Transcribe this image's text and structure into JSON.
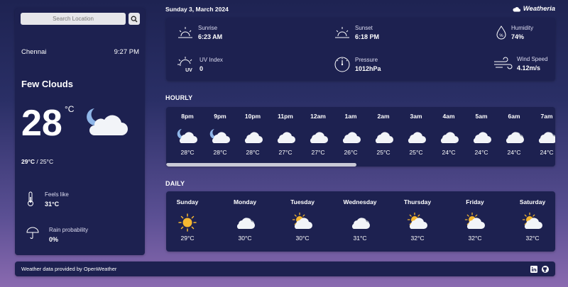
{
  "search": {
    "placeholder": "Search Location",
    "icon": "search-icon"
  },
  "location": {
    "city": "Chennai",
    "time": "9:27 PM"
  },
  "current": {
    "condition": "Few Clouds",
    "temp": "28",
    "unit": "°C",
    "hilo_high": "29°C",
    "hilo_sep": " / ",
    "hilo_low": "25°C",
    "feels_like_label": "Feels like",
    "feels_like": "31°C",
    "rain_label": "Rain probability",
    "rain": "0%"
  },
  "header": {
    "date": "Sunday 3, March 2024",
    "brand": "Weatheria"
  },
  "stats": {
    "sunrise_label": "Sunrise",
    "sunrise": "6:23 AM",
    "sunset_label": "Sunset",
    "sunset": "6:18 PM",
    "humidity_label": "Humidity",
    "humidity": "74%",
    "uv_label": "UV Index",
    "uv": "0",
    "pressure_label": "Pressure",
    "pressure": "1012hPa",
    "wind_label": "Wind Speed",
    "wind": "4.12m/s"
  },
  "hourly_title": "HOURLY",
  "hourly": [
    {
      "time": "8pm",
      "temp": "28°C",
      "icon": "moon-cloud"
    },
    {
      "time": "9pm",
      "temp": "28°C",
      "icon": "moon-cloud"
    },
    {
      "time": "10pm",
      "temp": "28°C",
      "icon": "cloud"
    },
    {
      "time": "11pm",
      "temp": "27°C",
      "icon": "cloud"
    },
    {
      "time": "12am",
      "temp": "27°C",
      "icon": "cloud"
    },
    {
      "time": "1am",
      "temp": "26°C",
      "icon": "cloud"
    },
    {
      "time": "2am",
      "temp": "25°C",
      "icon": "cloud"
    },
    {
      "time": "3am",
      "temp": "25°C",
      "icon": "cloud"
    },
    {
      "time": "4am",
      "temp": "24°C",
      "icon": "cloud"
    },
    {
      "time": "5am",
      "temp": "24°C",
      "icon": "cloud"
    },
    {
      "time": "6am",
      "temp": "24°C",
      "icon": "cloud-dark"
    },
    {
      "time": "7am",
      "temp": "24°C",
      "icon": "cloud-dark"
    }
  ],
  "daily_title": "DAILY",
  "daily": [
    {
      "day": "Sunday",
      "temp": "29°C",
      "icon": "sun"
    },
    {
      "day": "Monday",
      "temp": "30°C",
      "icon": "cloud-dark"
    },
    {
      "day": "Tuesday",
      "temp": "30°C",
      "icon": "sun-cloud"
    },
    {
      "day": "Wednesday",
      "temp": "31°C",
      "icon": "cloud-dark"
    },
    {
      "day": "Thursday",
      "temp": "32°C",
      "icon": "sun-cloud"
    },
    {
      "day": "Friday",
      "temp": "32°C",
      "icon": "sun-cloud"
    },
    {
      "day": "Saturday",
      "temp": "32°C",
      "icon": "sun-cloud"
    }
  ],
  "footer": {
    "text": "Weather data provided by OpenWeather",
    "links": [
      "linkedin-icon",
      "github-icon"
    ]
  },
  "colors": {
    "panel": "#1d2150",
    "sun": "#f5b731",
    "cloud": "#f2f4f8"
  }
}
